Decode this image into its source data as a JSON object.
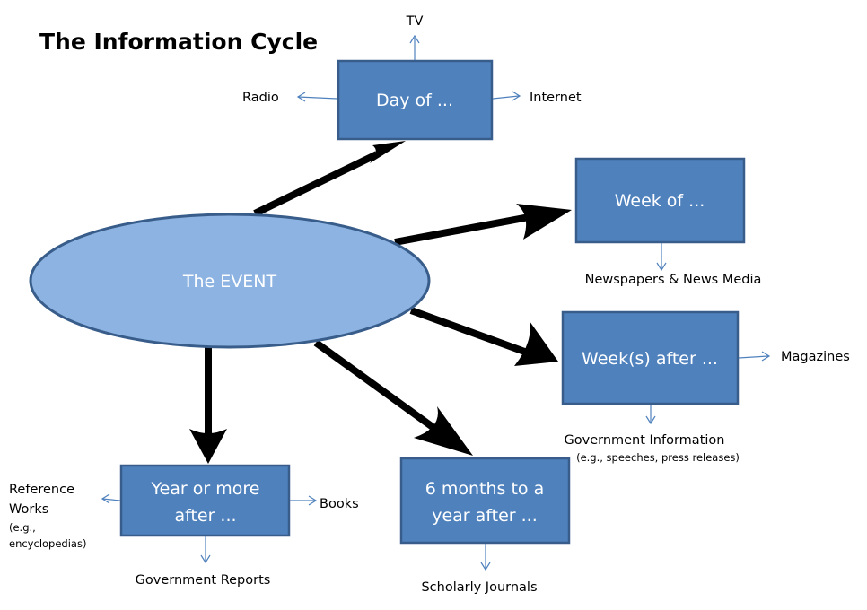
{
  "title": "The Information Cycle",
  "colors": {
    "box_fill": "#4f81bd",
    "box_border": "#385d8a",
    "event_fill": "#8db3e2",
    "connector_thin": "#4f81bd",
    "connector_thick": "#000000"
  },
  "center": {
    "label": "The EVENT"
  },
  "stages": [
    {
      "id": "day-of",
      "lines": [
        "Day of ..."
      ],
      "outputs": [
        {
          "direction": "up",
          "lines": [
            "TV"
          ]
        },
        {
          "direction": "left",
          "lines": [
            "Radio"
          ]
        },
        {
          "direction": "right",
          "lines": [
            "Internet"
          ]
        }
      ]
    },
    {
      "id": "week-of",
      "lines": [
        "Week of ..."
      ],
      "outputs": [
        {
          "direction": "down",
          "lines": [
            "Newspapers & News Media"
          ]
        }
      ]
    },
    {
      "id": "weeks-after",
      "lines": [
        "Week(s) after ..."
      ],
      "outputs": [
        {
          "direction": "right",
          "lines": [
            "Magazines"
          ]
        },
        {
          "direction": "down",
          "lines": [
            "Government Information"
          ],
          "note": "(e.g., speeches, press releases)"
        }
      ]
    },
    {
      "id": "six-months",
      "lines": [
        "6 months to a",
        "year after ..."
      ],
      "outputs": [
        {
          "direction": "down",
          "lines": [
            "Scholarly Journals"
          ]
        }
      ]
    },
    {
      "id": "year-or-more",
      "lines": [
        "Year or more",
        "after ..."
      ],
      "outputs": [
        {
          "direction": "right",
          "lines": [
            "Books"
          ]
        },
        {
          "direction": "down",
          "lines": [
            "Government Reports"
          ]
        },
        {
          "direction": "left",
          "lines": [
            "Reference",
            "Works"
          ],
          "note_lines": [
            "(e.g.,",
            "encyclopedias)"
          ]
        }
      ]
    }
  ]
}
